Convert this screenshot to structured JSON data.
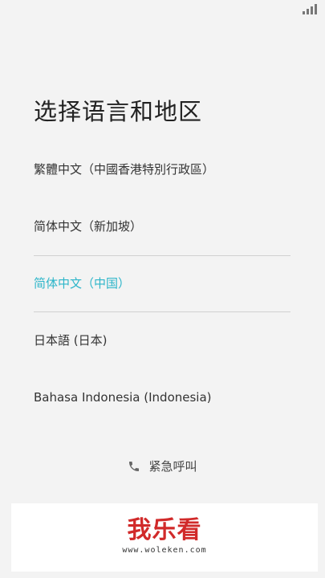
{
  "status_bar": {
    "icons": [
      "signal-icon"
    ]
  },
  "title": "选择语言和地区",
  "languages": [
    {
      "label": "繁體中文（中國香港特別行政區）",
      "selected": false
    },
    {
      "label": "简体中文（新加坡）",
      "selected": false
    },
    {
      "label": "简体中文（中国）",
      "selected": true
    },
    {
      "label": "日本語 (日本)",
      "selected": false
    },
    {
      "label": "Bahasa Indonesia (Indonesia)",
      "selected": false
    }
  ],
  "emergency_call": {
    "icon": "phone-icon",
    "label": "紧急呼叫"
  },
  "watermark": {
    "logo_text": "我乐看",
    "url": "www.woleken.com"
  },
  "colors": {
    "accent": "#2cb5c9",
    "background": "#f3f3f3",
    "text": "#333333",
    "watermark_red": "#d12a2a"
  }
}
